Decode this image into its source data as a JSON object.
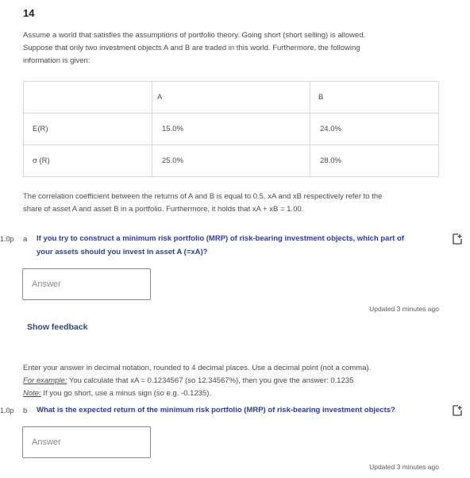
{
  "question_number": "14",
  "intro": {
    "lines": [
      "Assume a world that satisfies the assumptions of portfolio theory. Going short (short selling) is allowed.",
      "Suppose that only two investment objects A and B are traded in this world. Furthermore, the following",
      "information is given:"
    ]
  },
  "table": {
    "headers": [
      "",
      "A",
      "B"
    ],
    "rows": [
      {
        "label": "E(R)",
        "a": "15.0%",
        "b": "24.0%"
      },
      {
        "label": "σ (R)",
        "a": "25.0%",
        "b": "28.0%"
      }
    ]
  },
  "correlation_text": {
    "lines": [
      "The correlation coefficient between the returns of A and B is equal to 0.5. xA and xB respectively refer to the",
      "share of asset A and asset B in a portfolio. Furthermore, it holds that xA + xB = 1.00."
    ]
  },
  "part_a": {
    "points": "1.0p",
    "letter": "a",
    "question_lines": [
      "If you try to construct a minimum risk portfolio (MRP) of risk-bearing investment objects, which part of",
      "your assets should you invest in asset A (=xA)?"
    ],
    "answer_placeholder": "Answer",
    "updated": "Updated 3 minutes ago",
    "feedback_label": "Show feedback"
  },
  "instructions": {
    "line1": "Enter your answer in decimal notation, rounded to 4 decimal places. Use a decimal point (not a comma).",
    "example_label": "For example:",
    "example_text": " You calculate that xA = 0.1234567 (so 12.34567%), then you give the answer: 0.1235",
    "note_label": "Note:",
    "note_text": " If you go short, use a minus sign (so e.g. -0.1235)."
  },
  "part_b": {
    "points": "1.0p",
    "letter": "b",
    "question": "What is the expected return of the minimum risk portfolio (MRP) of risk-bearing investment objects?",
    "answer_placeholder": "Answer",
    "updated": "Updated 3 minutes ago"
  },
  "colors": {
    "question_text": "#2b3f9e",
    "feedback_link": "#2b4a7a",
    "body_text": "#4a4a4a"
  },
  "icons": {
    "flag": "flag-question-icon"
  }
}
